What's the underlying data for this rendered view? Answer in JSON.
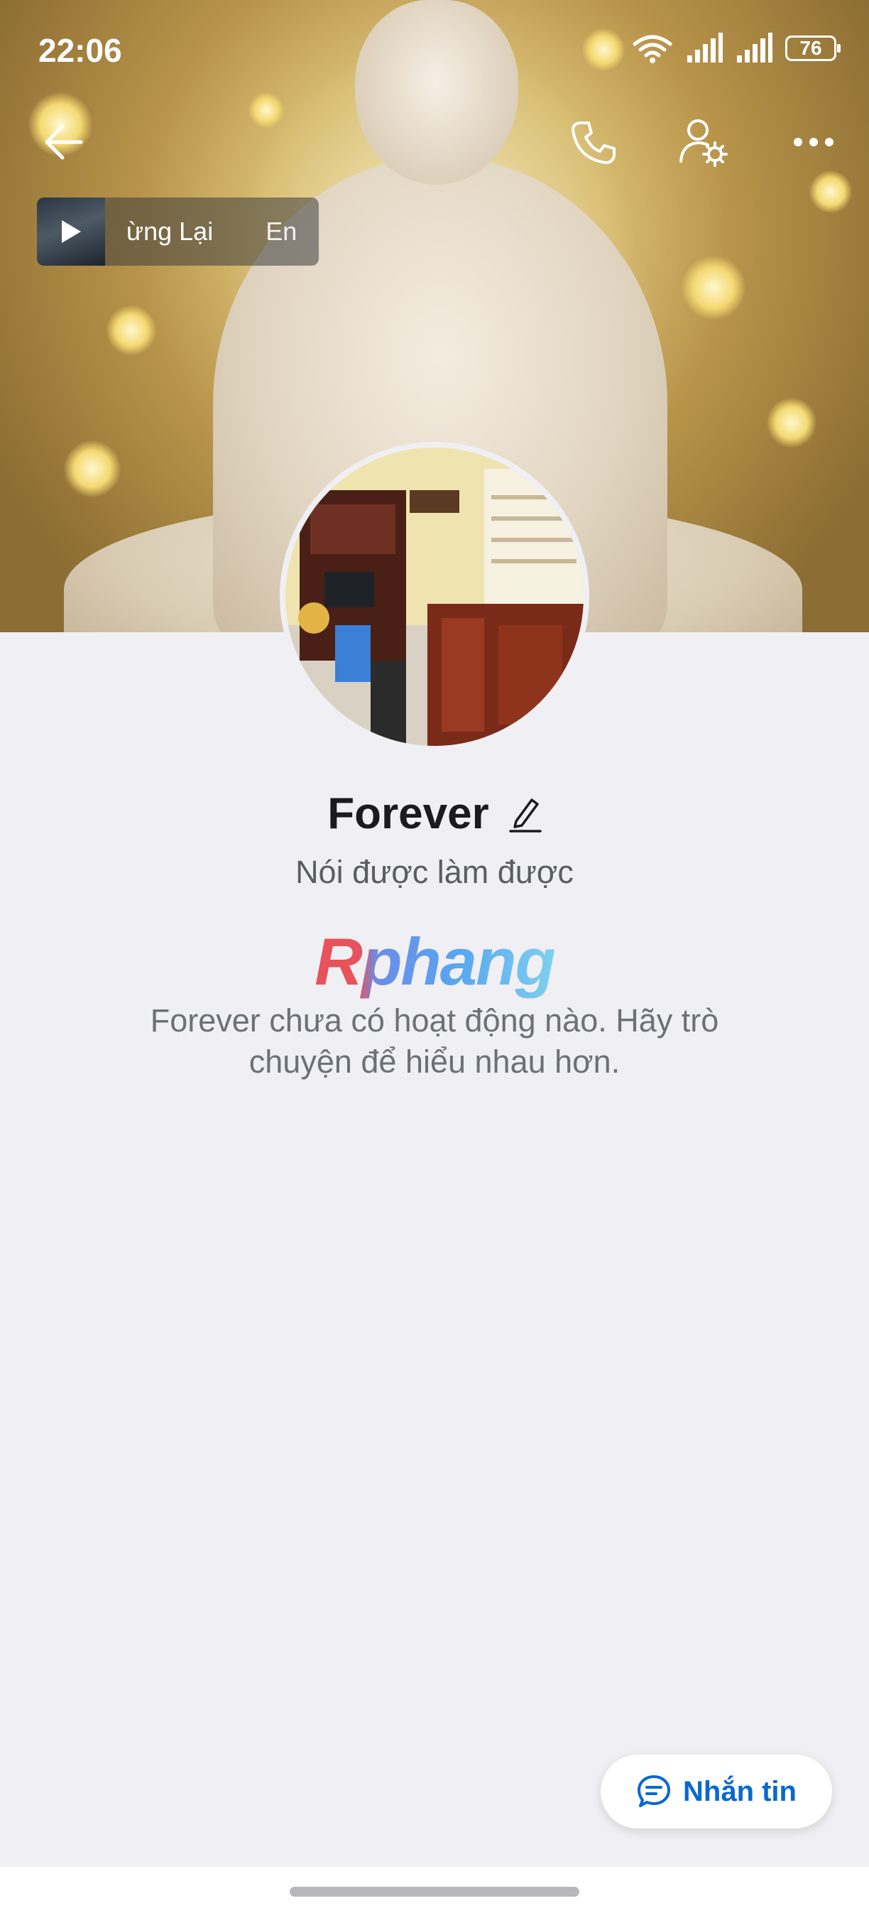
{
  "status_bar": {
    "time": "22:06",
    "battery": "76",
    "icons": [
      "wifi-icon",
      "signal-icon",
      "signal-icon",
      "battery-icon"
    ]
  },
  "nav": {
    "back_icon": "back-arrow-icon",
    "call_icon": "phone-icon",
    "settings_icon": "user-settings-icon",
    "more_icon": "more-icon"
  },
  "music": {
    "title": "ừng Lại",
    "artist": "En"
  },
  "profile": {
    "name": "Forever",
    "bio": "Nói được làm được",
    "watermark": "Rphang",
    "empty_message": "Forever chưa có hoạt động nào. Hãy trò chuyện để hiểu nhau hơn."
  },
  "actions": {
    "message_label": "Nhắn tin"
  },
  "colors": {
    "accent": "#0a68d0",
    "background": "#f0f0f4"
  }
}
